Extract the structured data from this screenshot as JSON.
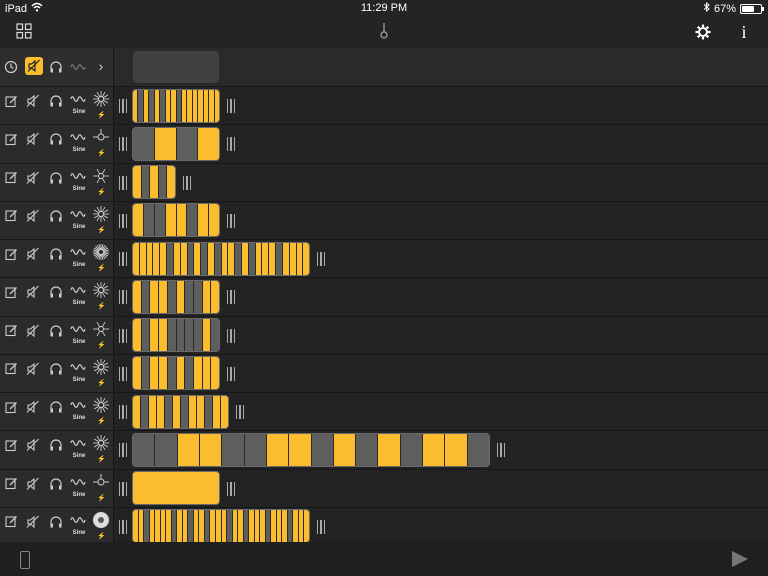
{
  "status": {
    "device": "iPad",
    "time": "11:29 PM",
    "battery": "67%",
    "battery_level": 0.67
  },
  "toolbar": {
    "left_icon": "grid-icon",
    "center_icon": "metronome-icon",
    "settings_icon": "gear-icon",
    "info_label": "i"
  },
  "header_row": {
    "icons": [
      "clock-icon",
      "mute-all-icon",
      "headphones-icon",
      "wave-icon",
      "chevron-right-icon"
    ],
    "chevron": "›"
  },
  "tracks": [
    {
      "wave_label": "Sine",
      "bolt": "⚡",
      "effect_icon": "burst-icon",
      "steps": [
        1,
        0,
        1,
        0,
        1,
        0,
        1,
        1,
        0,
        1,
        1,
        1,
        1,
        1,
        1,
        1
      ]
    },
    {
      "wave_label": "Sine",
      "bolt": "⚡",
      "effect_icon": "pin-icon",
      "steps": [
        0,
        1,
        0,
        1
      ]
    },
    {
      "wave_label": "Sine",
      "bolt": "⚡",
      "effect_icon": "sparkle-icon",
      "steps": [
        1,
        0,
        1,
        0,
        1
      ]
    },
    {
      "wave_label": "Sine",
      "bolt": "⚡",
      "effect_icon": "burst-icon",
      "steps": [
        1,
        0,
        0,
        1,
        1,
        0,
        1,
        1
      ]
    },
    {
      "wave_label": "Sine",
      "bolt": "⚡",
      "effect_icon": "radial-icon",
      "steps": [
        1,
        1,
        1,
        1,
        1,
        0,
        1,
        1,
        0,
        1,
        0,
        1,
        0,
        1,
        1,
        0,
        1,
        0,
        1,
        1,
        1,
        0,
        1,
        1,
        1,
        1
      ]
    },
    {
      "wave_label": "Sine",
      "bolt": "⚡",
      "effect_icon": "burst-icon",
      "steps": [
        1,
        0,
        1,
        1,
        0,
        1,
        0,
        0,
        1,
        1
      ]
    },
    {
      "wave_label": "Sine",
      "bolt": "⚡",
      "effect_icon": "sparkle-icon",
      "steps": [
        1,
        0,
        1,
        1,
        0,
        0,
        0,
        0,
        1,
        0
      ]
    },
    {
      "wave_label": "Sine",
      "bolt": "⚡",
      "effect_icon": "burst-icon",
      "steps": [
        1,
        0,
        1,
        1,
        0,
        1,
        0,
        1,
        1,
        1
      ]
    },
    {
      "wave_label": "Sine",
      "bolt": "⚡",
      "effect_icon": "burst-icon",
      "steps": [
        1,
        0,
        1,
        1,
        0,
        1,
        0,
        1,
        1,
        0,
        1,
        1
      ]
    },
    {
      "wave_label": "Sine",
      "bolt": "⚡",
      "effect_icon": "burst-icon",
      "steps": [
        0,
        0,
        1,
        1,
        0,
        0,
        1,
        1,
        0,
        1,
        0,
        1,
        0,
        1,
        1,
        0
      ]
    },
    {
      "wave_label": "Sine",
      "bolt": "⚡",
      "effect_icon": "pin-icon",
      "steps": [
        1
      ]
    },
    {
      "wave_label": "Sine",
      "bolt": "⚡",
      "effect_icon": "disc-icon",
      "steps": [
        1,
        1,
        0,
        1,
        1,
        1,
        1,
        0,
        1,
        1,
        0,
        1,
        1,
        0,
        1,
        1,
        1,
        0,
        1,
        1,
        0,
        1,
        1,
        1,
        0,
        1,
        1,
        1,
        0,
        1,
        1,
        1
      ]
    }
  ],
  "colors": {
    "active": "#fbbd2e",
    "inactive": "#5e5e5e",
    "background": "#242424"
  },
  "bottom": {
    "play_icon": "play-icon",
    "handle_icon": "drag-handle-icon"
  }
}
